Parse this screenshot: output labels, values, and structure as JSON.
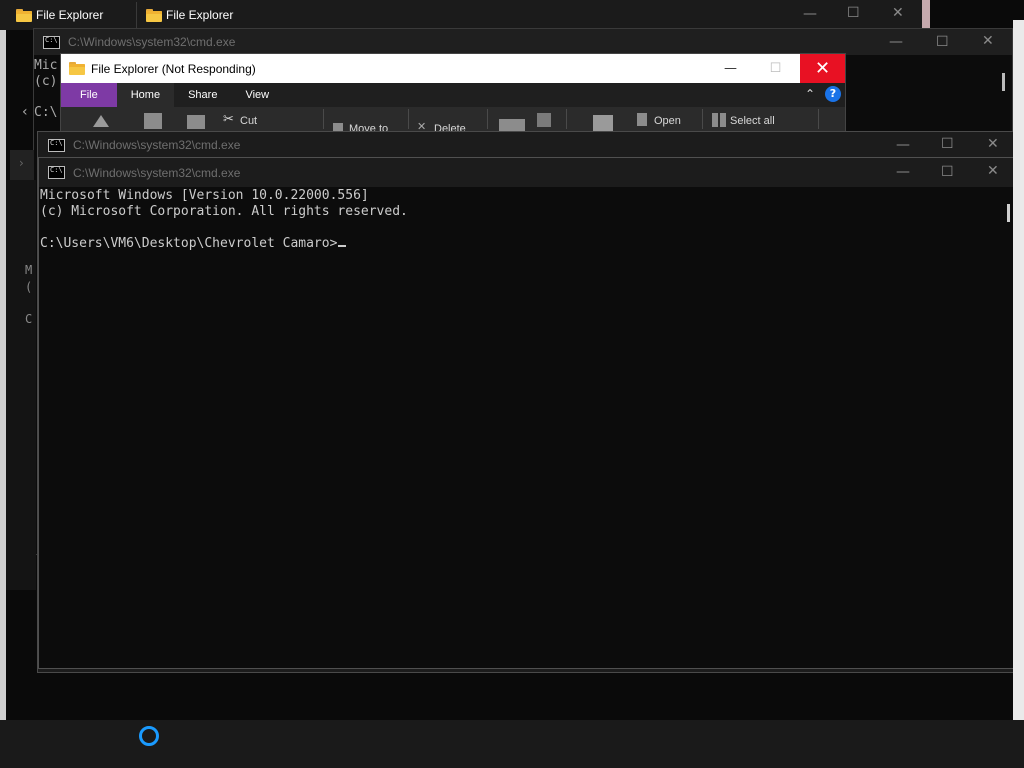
{
  "background_explorer": {
    "tabs": [
      {
        "label": "File Explorer"
      },
      {
        "label": "File Explorer"
      }
    ]
  },
  "cmd_back": {
    "title": "C:\\Windows\\system32\\cmd.exe",
    "partial_lines": [
      "Mic",
      "(c)",
      "C:\\"
    ]
  },
  "left_remnants": [
    "M",
    "(",
    "C"
  ],
  "explorer": {
    "title": "File Explorer (Not Responding)",
    "tabs": [
      "File",
      "Home",
      "Share",
      "View"
    ],
    "ribbon": {
      "cut": "Cut",
      "move_to": "Move to",
      "delete": "Delete",
      "open": "Open",
      "select_all": "Select all"
    }
  },
  "cmd_middle": {
    "title": "C:\\Windows\\system32\\cmd.exe"
  },
  "cmd_front": {
    "title": "C:\\Windows\\system32\\cmd.exe",
    "lines": [
      "Microsoft Windows [Version 10.0.22000.556]",
      "(c) Microsoft Corporation. All rights reserved.",
      "",
      "C:\\Users\\VM6\\Desktop\\Chevrolet Camaro>"
    ]
  },
  "colors": {
    "explorer_file_tab": "#7e3aa5",
    "close_red": "#e81123",
    "cortana_blue": "#1a9bff"
  },
  "icons": {
    "window_minimize": "minimize-icon",
    "window_maximize": "maximize-icon",
    "window_close": "close-icon"
  }
}
